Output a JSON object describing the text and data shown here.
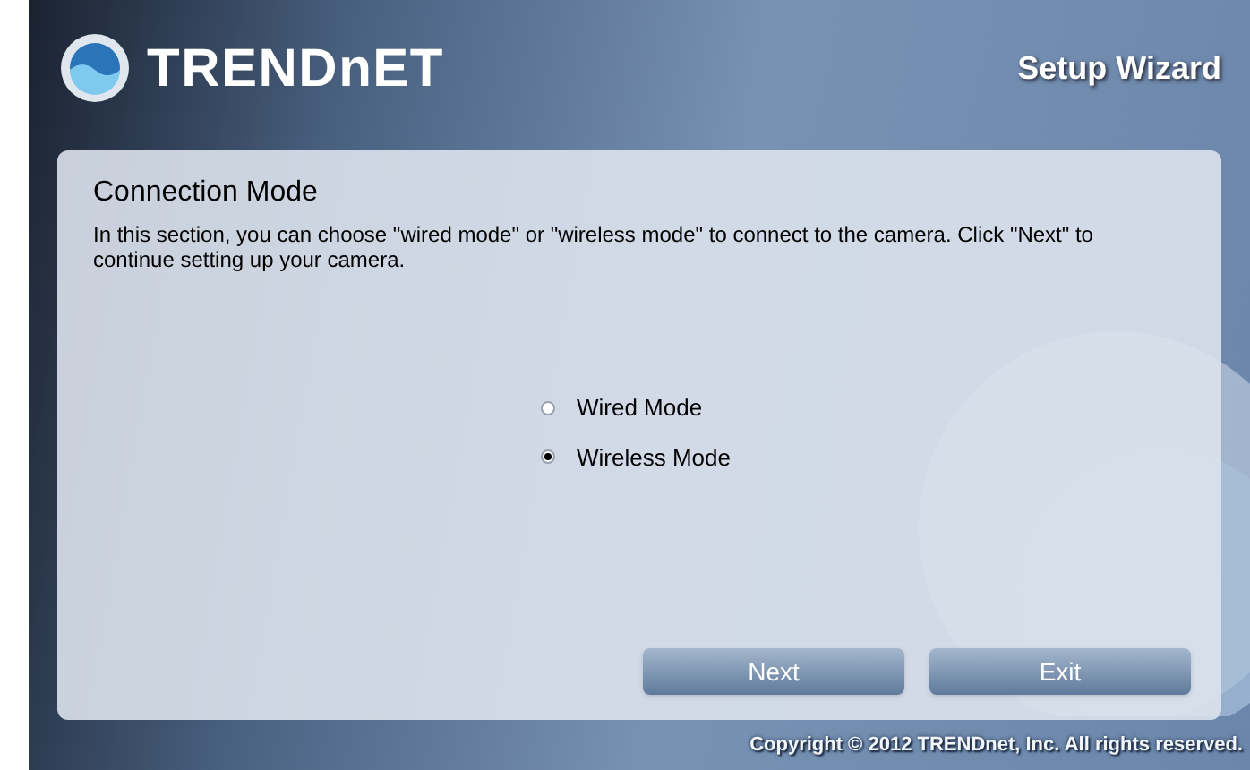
{
  "header": {
    "logo": "TRENDnET",
    "title": "Setup Wizard"
  },
  "panel": {
    "heading": "Connection Mode",
    "description": "In this section, you can choose \"wired mode\" or \"wireless mode\" to connect to the camera. Click \"Next\" to continue setting up your camera."
  },
  "modes": [
    {
      "label": "Wired Mode",
      "selected": false
    },
    {
      "label": "Wireless Mode",
      "selected": true
    }
  ],
  "buttons": [
    "Next",
    "Exit"
  ],
  "footer": "Copyright © 2012 TRENDnet, Inc. All rights reserved."
}
